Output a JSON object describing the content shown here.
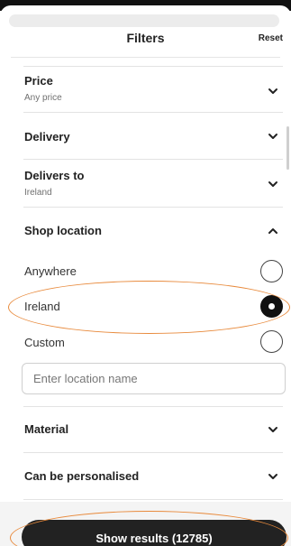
{
  "header": {
    "title": "Filters",
    "reset_label": "Reset"
  },
  "filters": [
    {
      "title": "Price",
      "subtitle": "Any price"
    },
    {
      "title": "Delivery"
    },
    {
      "title": "Delivers to",
      "subtitle": "Ireland"
    },
    {
      "title": "Shop location"
    },
    {
      "title": "Material"
    },
    {
      "title": "Can be personalised"
    }
  ],
  "shop_location": {
    "options": [
      {
        "label": "Anywhere",
        "selected": false
      },
      {
        "label": "Ireland",
        "selected": true
      },
      {
        "label": "Custom",
        "selected": false
      }
    ],
    "location_placeholder": "Enter location name"
  },
  "footer": {
    "show_results_label": "Show results (12785)"
  },
  "colors": {
    "primary": "#222222",
    "annotation": "#e88a3c",
    "divider": "#e3e3e3"
  }
}
